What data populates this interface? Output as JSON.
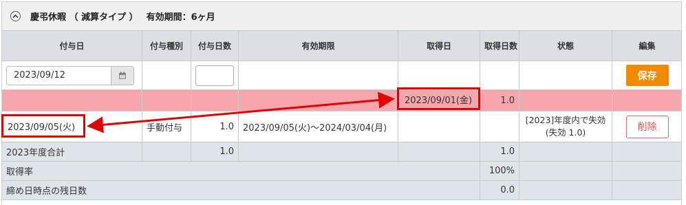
{
  "section": {
    "title": "慶弔休暇 （ 減算タイプ ）",
    "validity": "有効期間：6ヶ月"
  },
  "columns": [
    "付与日",
    "付与種別",
    "付与日数",
    "有効期限",
    "取得日",
    "取得日数",
    "状態",
    "編集"
  ],
  "input_row": {
    "grant_date": "2023/09/12",
    "save_label": "保存"
  },
  "pink_row": {
    "acquired_date": "2023/09/01(金)",
    "acquired_days": "1.0"
  },
  "grant_row": {
    "grant_date": "2023/09/05(火)",
    "grant_type": "手動付与",
    "grant_days": "1.0",
    "validity_period": "2023/09/05(火)～2024/03/04(月)",
    "status_line1": "[2023]年度内で失効",
    "status_line2": "(失効 1.0)",
    "delete_label": "削除"
  },
  "summary": {
    "year_total_label": "2023年度合計",
    "year_total_grant": "1.0",
    "year_total_acquired": "1.0",
    "rate_label": "取得率",
    "rate_value": "100%",
    "remaining_label": "締め日時点の残日数",
    "remaining_value": "0.0"
  },
  "colors": {
    "pink_row": "#f7a6ae",
    "save_button": "#f28a00",
    "highlight": "#e00000",
    "summary_row": "#dfe3ea"
  },
  "icons": [
    "chevron-up-icon",
    "calendar-icon"
  ]
}
